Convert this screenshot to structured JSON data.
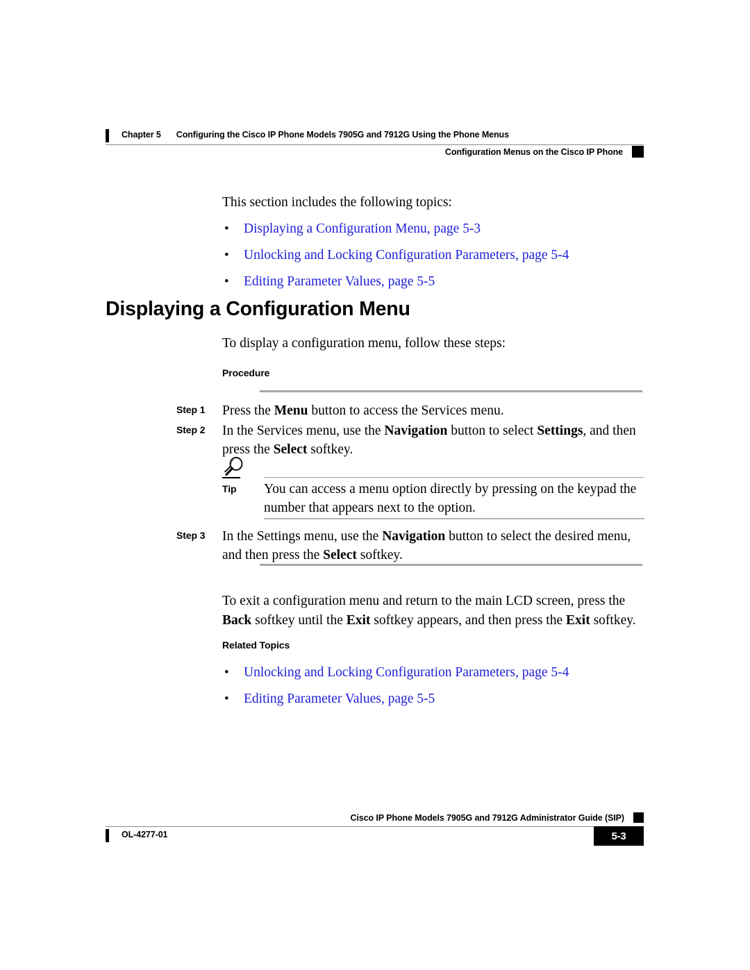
{
  "header": {
    "chapter_label": "Chapter 5",
    "chapter_title": "Configuring the Cisco IP Phone Models 7905G and 7912G Using the Phone Menus",
    "section_title": "Configuration Menus on the Cisco IP Phone"
  },
  "intro": {
    "lead": "This section includes the following topics:",
    "topics": [
      {
        "bullet": "•",
        "text": "Displaying a Configuration Menu, page 5-3"
      },
      {
        "bullet": "•",
        "text": "Unlocking and Locking Configuration Parameters, page 5-4"
      },
      {
        "bullet": "•",
        "text": "Editing Parameter Values, page 5-5"
      }
    ]
  },
  "section": {
    "heading": "Displaying a Configuration Menu",
    "intro": "To display a configuration menu, follow these steps:",
    "procedure_label": "Procedure"
  },
  "steps": [
    {
      "number": "Step 1",
      "text_parts": [
        {
          "t": "Press the ",
          "b": false
        },
        {
          "t": "Menu",
          "b": true
        },
        {
          "t": " button to access the Services menu.",
          "b": false
        }
      ]
    },
    {
      "number": "Step 2",
      "text_parts": [
        {
          "t": "In the Services menu, use the ",
          "b": false
        },
        {
          "t": "Navigation",
          "b": true
        },
        {
          "t": " button to select ",
          "b": false
        },
        {
          "t": "Settings",
          "b": true
        },
        {
          "t": ", and then press the ",
          "b": false
        },
        {
          "t": "Select",
          "b": true
        },
        {
          "t": " softkey.",
          "b": false
        }
      ]
    },
    {
      "number": "Step 3",
      "text_parts": [
        {
          "t": "In the Settings menu, use the ",
          "b": false
        },
        {
          "t": "Navigation",
          "b": true
        },
        {
          "t": " button to select the desired menu, and then press the ",
          "b": false
        },
        {
          "t": "Select",
          "b": true
        },
        {
          "t": " softkey.",
          "b": false
        }
      ]
    }
  ],
  "tip": {
    "icon": "lightbulb-icon",
    "label": "Tip",
    "text": "You can access a menu option directly by pressing on the keypad the number that appears next to the option."
  },
  "exit_paragraph": {
    "parts": [
      {
        "t": "To exit a configuration menu and return to the main LCD screen, press the ",
        "b": false
      },
      {
        "t": "Back",
        "b": true
      },
      {
        "t": " softkey until the ",
        "b": false
      },
      {
        "t": "Exit",
        "b": true
      },
      {
        "t": " softkey appears, and then press the ",
        "b": false
      },
      {
        "t": "Exit",
        "b": true
      },
      {
        "t": " softkey.",
        "b": false
      }
    ]
  },
  "related": {
    "label": "Related Topics",
    "topics": [
      {
        "bullet": "•",
        "text": "Unlocking and Locking Configuration Parameters, page 5-4"
      },
      {
        "bullet": "•",
        "text": "Editing Parameter Values, page 5-5"
      }
    ]
  },
  "footer": {
    "guide_title": "Cisco IP Phone Models 7905G and 7912G Administrator Guide (SIP)",
    "doc_id": "OL-4277-01",
    "page_number": "5-3"
  },
  "colors": {
    "link_blue": "#2020d8",
    "rule_gray": "#a6a6a6",
    "black": "#000000"
  }
}
